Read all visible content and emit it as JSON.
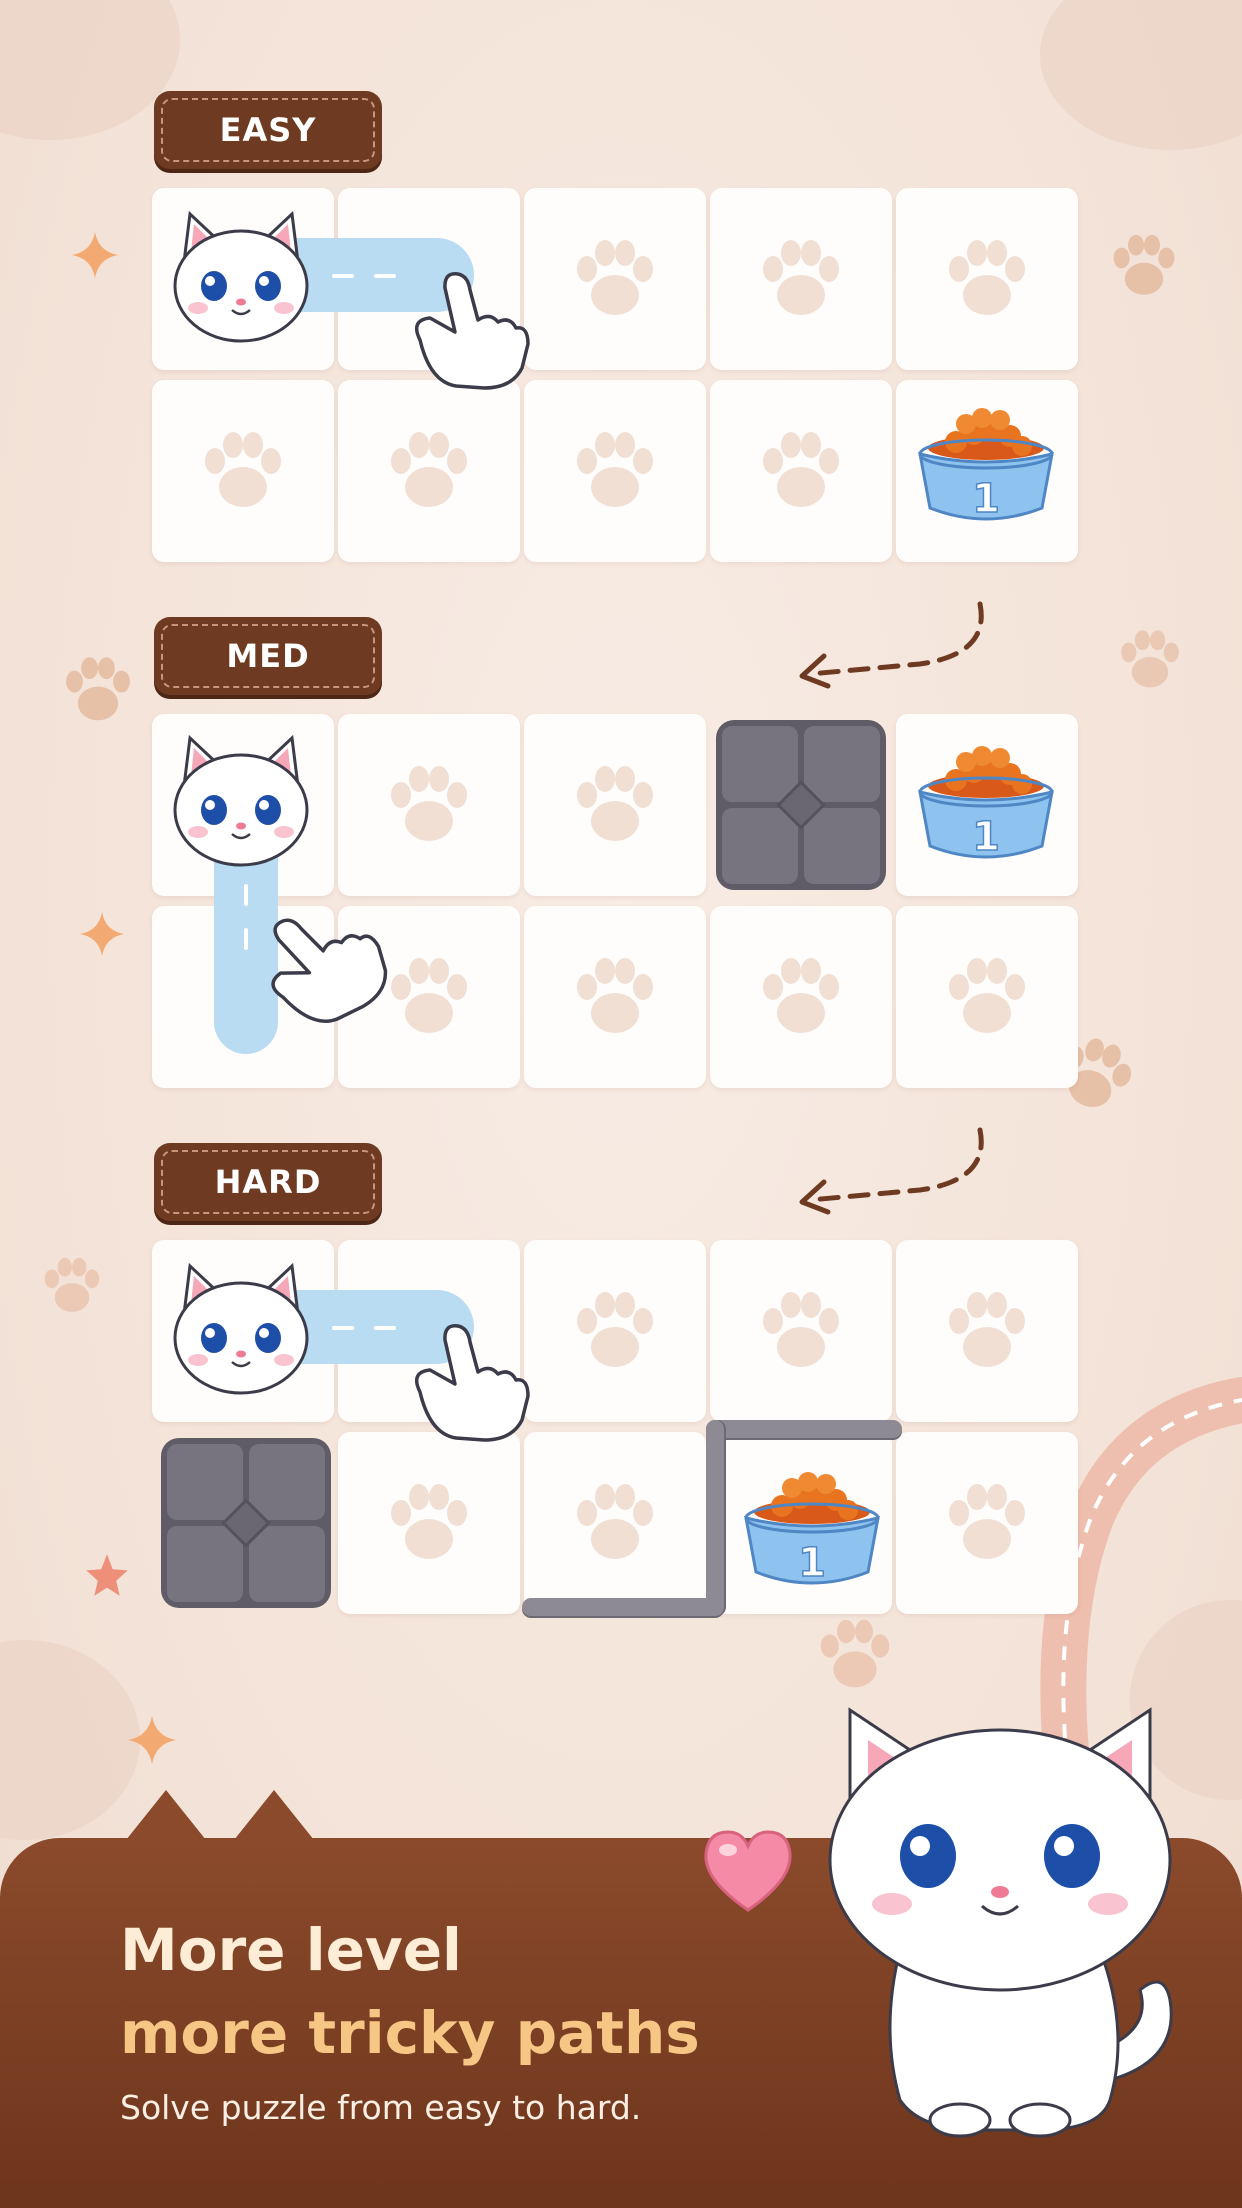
{
  "levels": [
    {
      "label": "EASY"
    },
    {
      "label": "MED"
    },
    {
      "label": "HARD"
    }
  ],
  "bowl_number": "1",
  "footer": {
    "headline_line1": "More level",
    "headline_line2": "more tricky paths",
    "subtitle": "Solve puzzle from easy to hard."
  },
  "colors": {
    "brown": "#6f3a22",
    "path_blue": "#b9dcf2",
    "rock": "#6c6973",
    "headline_gold": "#f6c784"
  },
  "icons": [
    "paw-icon",
    "cat-icon",
    "food-bowl-icon",
    "rock-block-icon",
    "pointing-hand-icon",
    "dashed-arrow-icon",
    "sparkle-icon",
    "heart-icon"
  ]
}
